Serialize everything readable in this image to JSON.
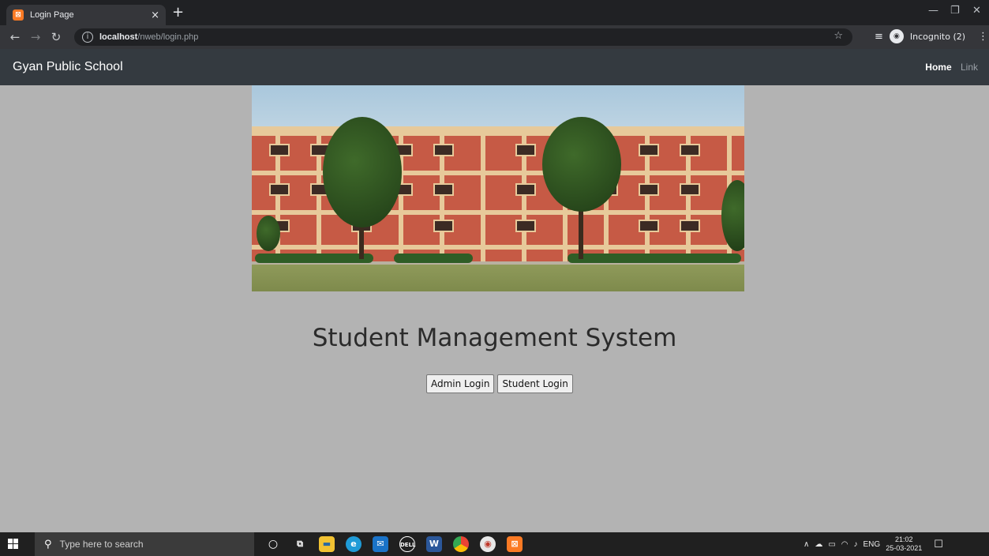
{
  "browser": {
    "tab_title": "Login Page",
    "tab_close": "×",
    "new_tab": "+",
    "url_host": "localhost",
    "url_path": "/nweb/login.php",
    "profile_label": "Incognito (2)",
    "window_controls": [
      "—",
      "❐",
      "✕"
    ]
  },
  "navbar": {
    "brand": "Gyan Public School",
    "links": [
      "Home",
      "Link"
    ]
  },
  "hero": {
    "image_alt": "school-building-photo"
  },
  "main": {
    "title": "Student Management System",
    "admin_button": "Admin Login",
    "student_button": "Student Login"
  },
  "taskbar": {
    "search_placeholder": "Type here to search",
    "tray_lang": "ENG",
    "time": "21:02",
    "date": "25-03-2021"
  },
  "colors": {
    "page_bg": "#b3b3b3",
    "navbar_bg": "#343a40",
    "chrome_dark": "#202124"
  }
}
